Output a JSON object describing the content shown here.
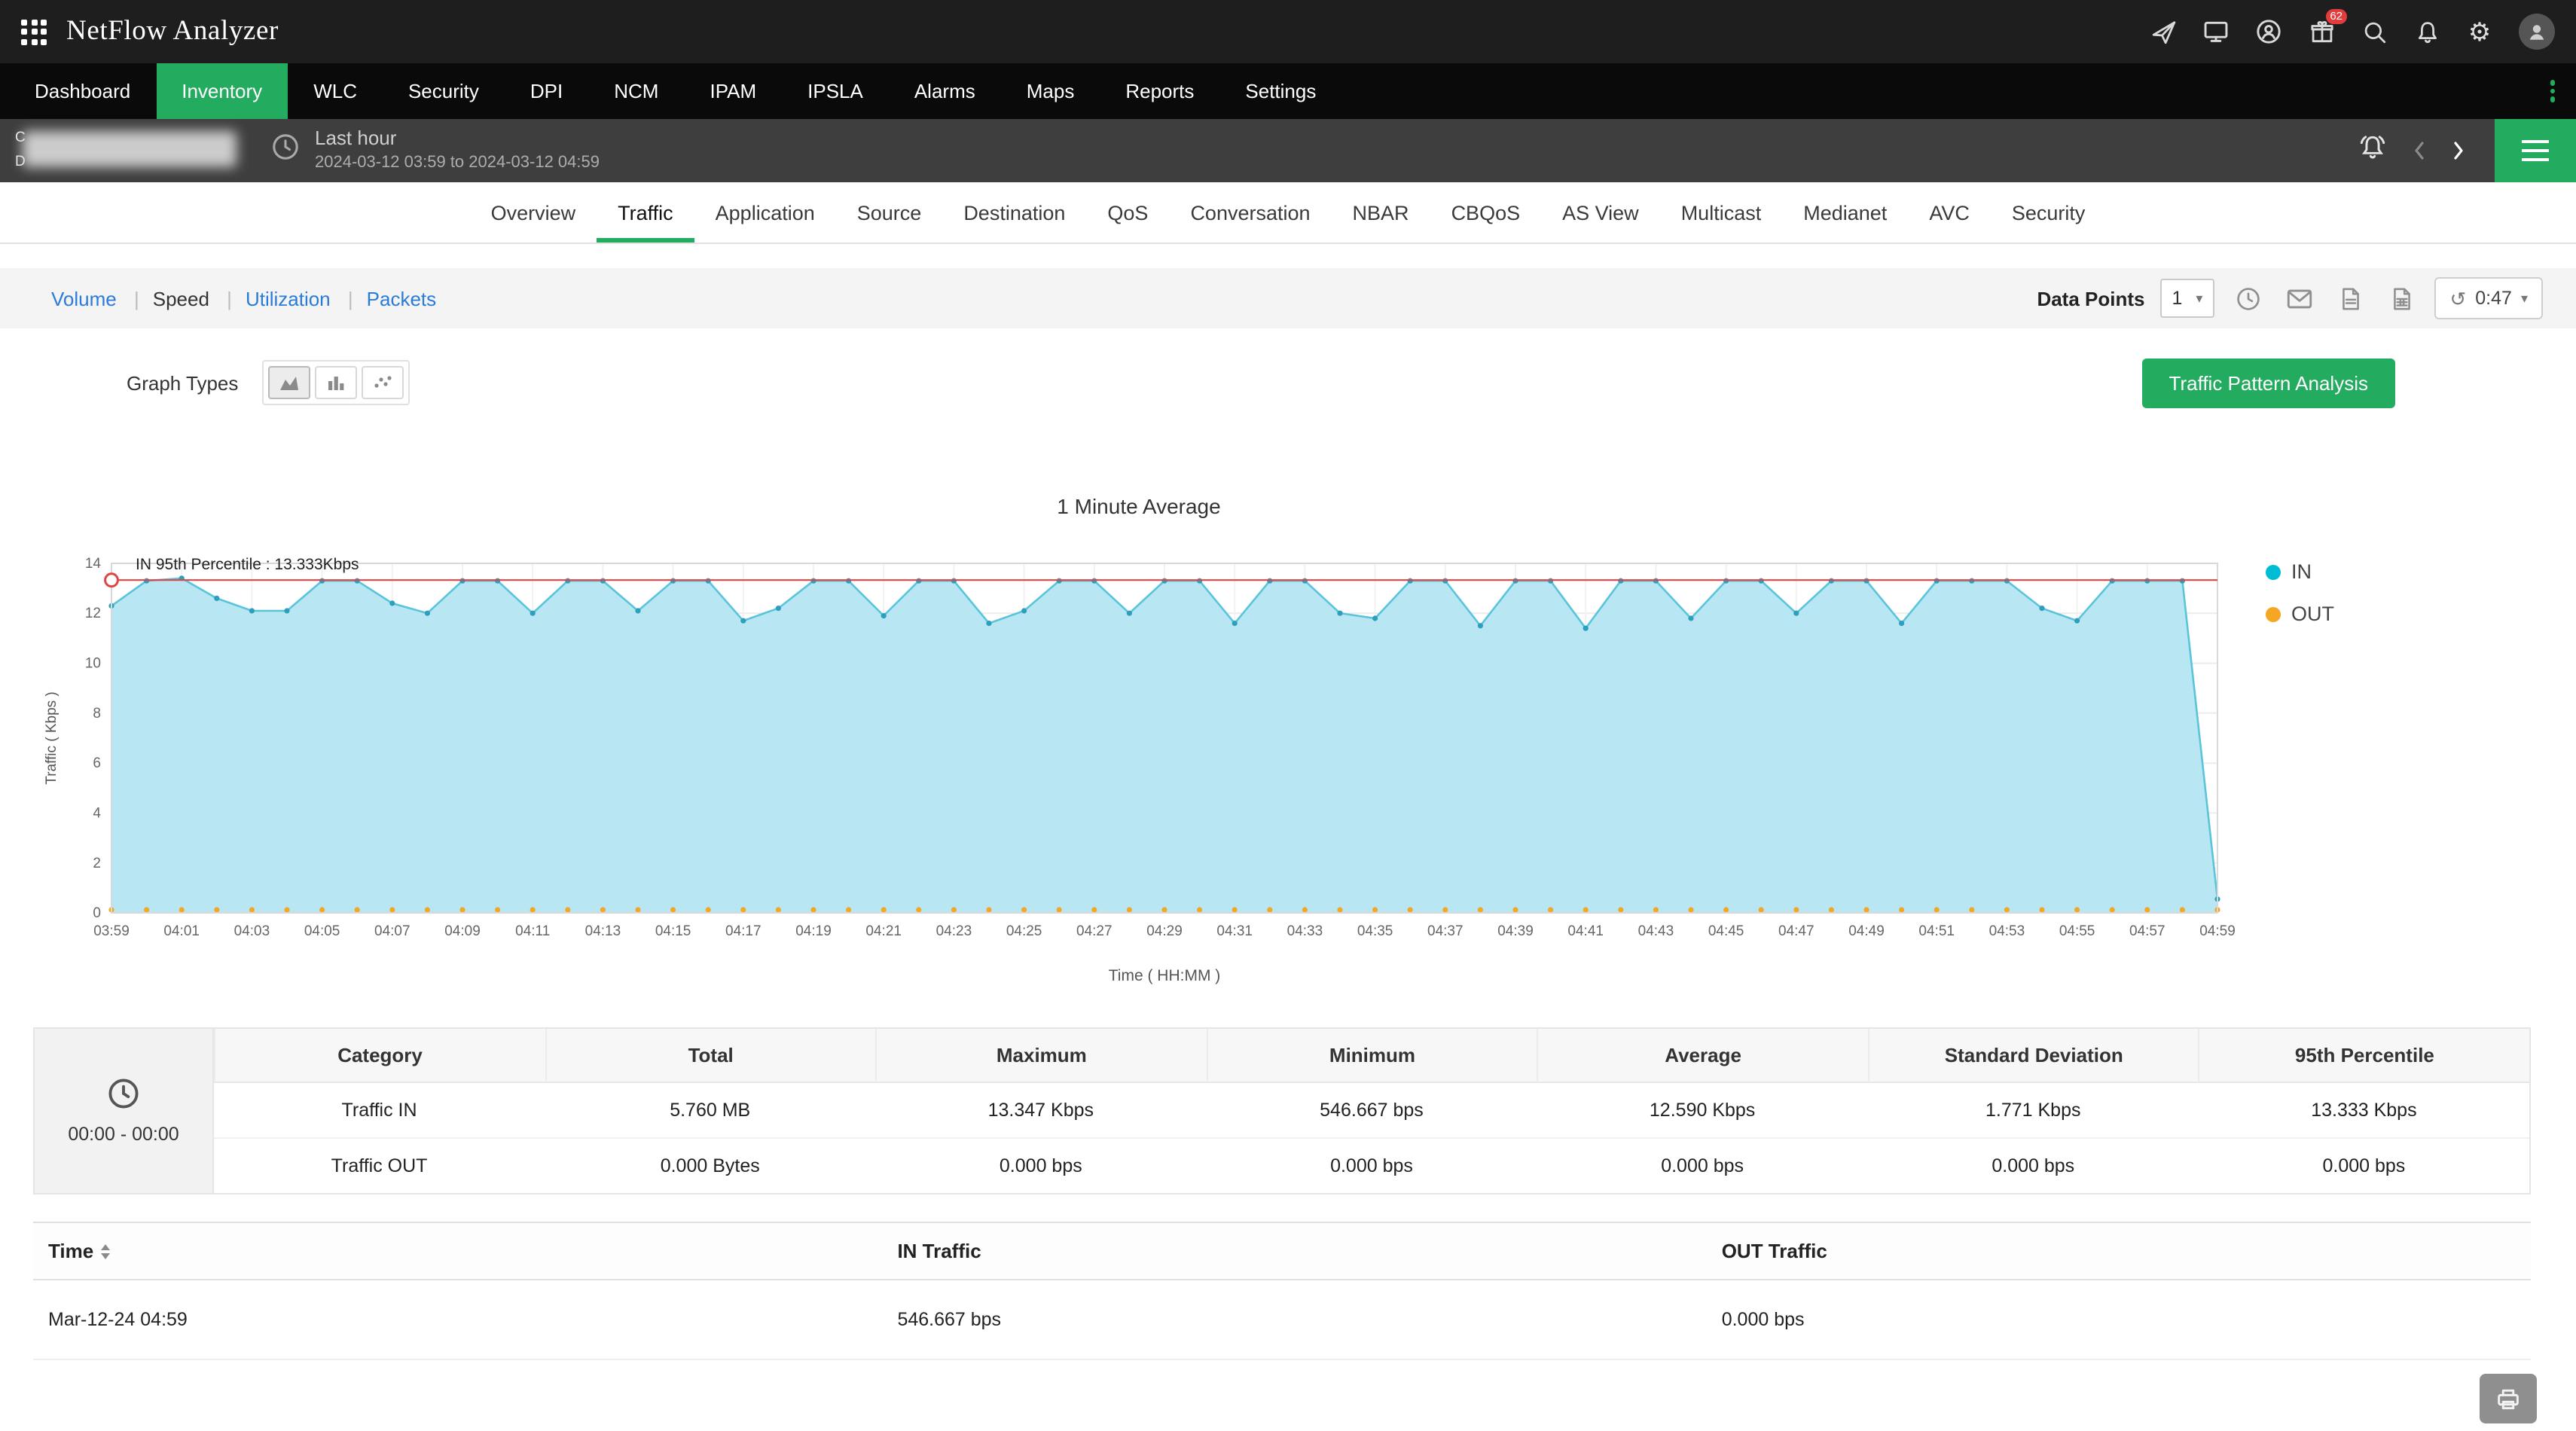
{
  "topbar": {
    "title": "NetFlow Analyzer",
    "badge_count": "62"
  },
  "nav": {
    "items": [
      {
        "label": "Dashboard"
      },
      {
        "label": "Inventory",
        "active": true
      },
      {
        "label": "WLC"
      },
      {
        "label": "Security"
      },
      {
        "label": "DPI"
      },
      {
        "label": "NCM"
      },
      {
        "label": "IPAM"
      },
      {
        "label": "IPSLA"
      },
      {
        "label": "Alarms"
      },
      {
        "label": "Maps"
      },
      {
        "label": "Reports"
      },
      {
        "label": "Settings"
      }
    ]
  },
  "header": {
    "device_line1": "C",
    "device_line2": "D",
    "period_label": "Last hour",
    "period_range": "2024-03-12 03:59 to 2024-03-12 04:59"
  },
  "tabs": {
    "items": [
      {
        "label": "Overview"
      },
      {
        "label": "Traffic",
        "active": true
      },
      {
        "label": "Application"
      },
      {
        "label": "Source"
      },
      {
        "label": "Destination"
      },
      {
        "label": "QoS"
      },
      {
        "label": "Conversation"
      },
      {
        "label": "NBAR"
      },
      {
        "label": "CBQoS"
      },
      {
        "label": "AS View"
      },
      {
        "label": "Multicast"
      },
      {
        "label": "Medianet"
      },
      {
        "label": "AVC"
      },
      {
        "label": "Security"
      }
    ]
  },
  "subnav": {
    "items": [
      {
        "label": "Volume"
      },
      {
        "label": "Speed",
        "active": true
      },
      {
        "label": "Utilization"
      },
      {
        "label": "Packets"
      }
    ]
  },
  "toolbar": {
    "data_points_label": "Data Points",
    "data_points_value": "1",
    "refresh_timer": "0:47"
  },
  "graph_controls": {
    "label": "Graph Types",
    "analysis_button": "Traffic Pattern Analysis"
  },
  "chart_data": {
    "type": "area",
    "title": "1 Minute Average",
    "xlabel": "Time ( HH:MM )",
    "ylabel": "Traffic ( Kbps )",
    "ylim": [
      0,
      14
    ],
    "yticks": [
      0,
      2,
      4,
      6,
      8,
      10,
      12,
      14
    ],
    "x_tick_labels": [
      "03:59",
      "04:01",
      "04:03",
      "04:05",
      "04:07",
      "04:09",
      "04:11",
      "04:13",
      "04:15",
      "04:17",
      "04:19",
      "04:21",
      "04:23",
      "04:25",
      "04:27",
      "04:29",
      "04:31",
      "04:33",
      "04:35",
      "04:37",
      "04:39",
      "04:41",
      "04:43",
      "04:45",
      "04:47",
      "04:49",
      "04:51",
      "04:53",
      "04:55",
      "04:57",
      "04:59"
    ],
    "grid": true,
    "legend_position": "right",
    "series": [
      {
        "name": "IN",
        "color": "#00bcd4",
        "line_color": "#59c4da",
        "fill_color": "#b8e7f3",
        "dot_color": "#2d9fbd",
        "values": [
          12.3,
          13.3,
          13.4,
          12.6,
          12.1,
          12.1,
          13.3,
          13.3,
          12.4,
          12.0,
          13.3,
          13.3,
          12.0,
          13.3,
          13.3,
          12.1,
          13.3,
          13.3,
          11.7,
          12.2,
          13.3,
          13.3,
          11.9,
          13.3,
          13.3,
          11.6,
          12.1,
          13.3,
          13.3,
          12.0,
          13.3,
          13.3,
          11.6,
          13.3,
          13.3,
          12.0,
          11.8,
          13.3,
          13.3,
          11.5,
          13.3,
          13.3,
          11.4,
          13.3,
          13.3,
          11.8,
          13.3,
          13.3,
          12.0,
          13.3,
          13.3,
          11.6,
          13.3,
          13.3,
          13.3,
          12.2,
          11.7,
          13.3,
          13.3,
          13.3,
          0.547
        ]
      },
      {
        "name": "OUT",
        "color": "#f5a623",
        "dot_color": "#f5a623",
        "values": [
          0,
          0,
          0,
          0,
          0,
          0,
          0,
          0,
          0,
          0,
          0,
          0,
          0,
          0,
          0,
          0,
          0,
          0,
          0,
          0,
          0,
          0,
          0,
          0,
          0,
          0,
          0,
          0,
          0,
          0,
          0,
          0,
          0,
          0,
          0,
          0,
          0,
          0,
          0,
          0,
          0,
          0,
          0,
          0,
          0,
          0,
          0,
          0,
          0,
          0,
          0,
          0,
          0,
          0,
          0,
          0,
          0,
          0,
          0,
          0,
          0
        ]
      }
    ],
    "percentile_line": {
      "label": "IN 95th Percentile : 13.333Kbps",
      "value": 13.333,
      "color": "#e04545"
    }
  },
  "summary_table": {
    "time_range": "00:00 - 00:00",
    "headers": [
      "Category",
      "Total",
      "Maximum",
      "Minimum",
      "Average",
      "Standard Deviation",
      "95th Percentile"
    ],
    "rows": [
      {
        "category": "Traffic IN",
        "total": "5.760 MB",
        "max": "13.347 Kbps",
        "min": "546.667 bps",
        "avg": "12.590 Kbps",
        "stddev": "1.771 Kbps",
        "p95": "13.333 Kbps"
      },
      {
        "category": "Traffic OUT",
        "total": "0.000 Bytes",
        "max": "0.000 bps",
        "min": "0.000 bps",
        "avg": "0.000 bps",
        "stddev": "0.000 bps",
        "p95": "0.000 bps"
      }
    ]
  },
  "detail_table": {
    "headers": [
      "Time",
      "IN Traffic",
      "OUT Traffic"
    ],
    "rows": [
      {
        "time": "Mar-12-24 04:59",
        "in": "546.667 bps",
        "out": "0.000 bps"
      }
    ]
  }
}
